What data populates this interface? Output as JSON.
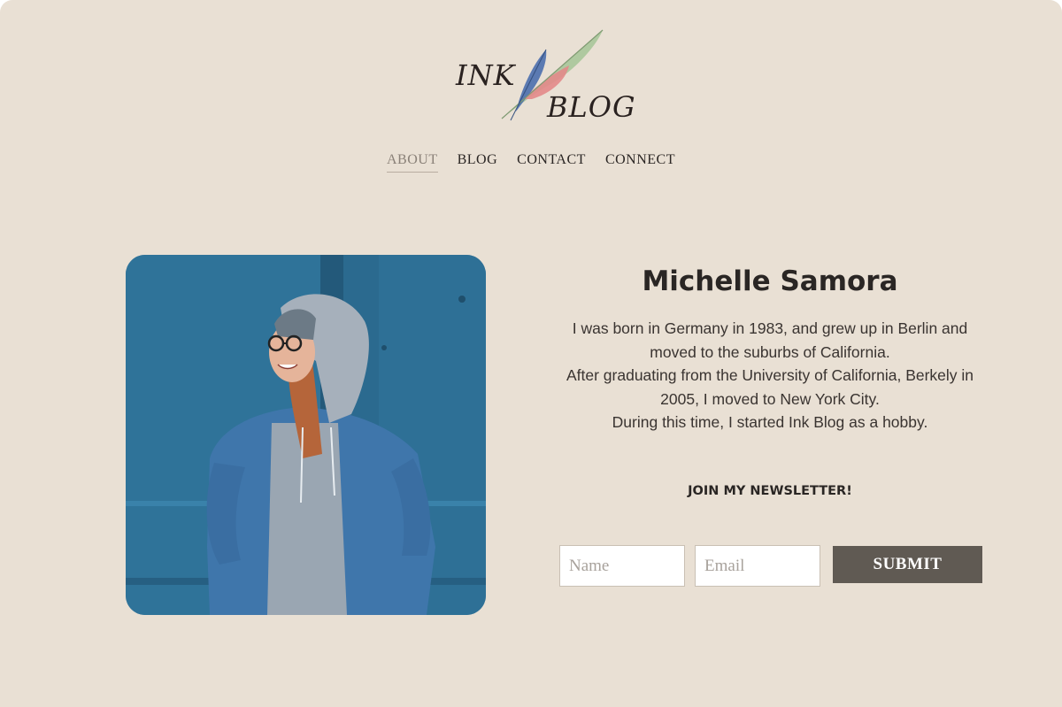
{
  "logo": {
    "line1": "INK",
    "line2": "BLOG",
    "feather_colors": [
      "#a9c79a",
      "#e38a8a",
      "#4b6fae"
    ]
  },
  "nav": {
    "items": [
      {
        "label": "ABOUT",
        "active": true
      },
      {
        "label": "BLOG",
        "active": false
      },
      {
        "label": "CONTACT",
        "active": false
      },
      {
        "label": "CONNECT",
        "active": false
      }
    ]
  },
  "profile": {
    "name": "Michelle Samora",
    "bio_lines": [
      "I was born in Germany in 1983, and grew up in Berlin and",
      "moved to the suburbs of California.",
      "After graduating from the University of California, Berkely in",
      "2005, I moved to New York City.",
      "During this time, I started Ink Blog as a hobby."
    ]
  },
  "newsletter": {
    "heading": "JOIN MY NEWSLETTER!",
    "name_placeholder": "Name",
    "email_placeholder": "Email",
    "submit_label": "SUBMIT"
  },
  "colors": {
    "background": "#e9e0d4",
    "button": "#605a53",
    "text": "#2a2624"
  }
}
